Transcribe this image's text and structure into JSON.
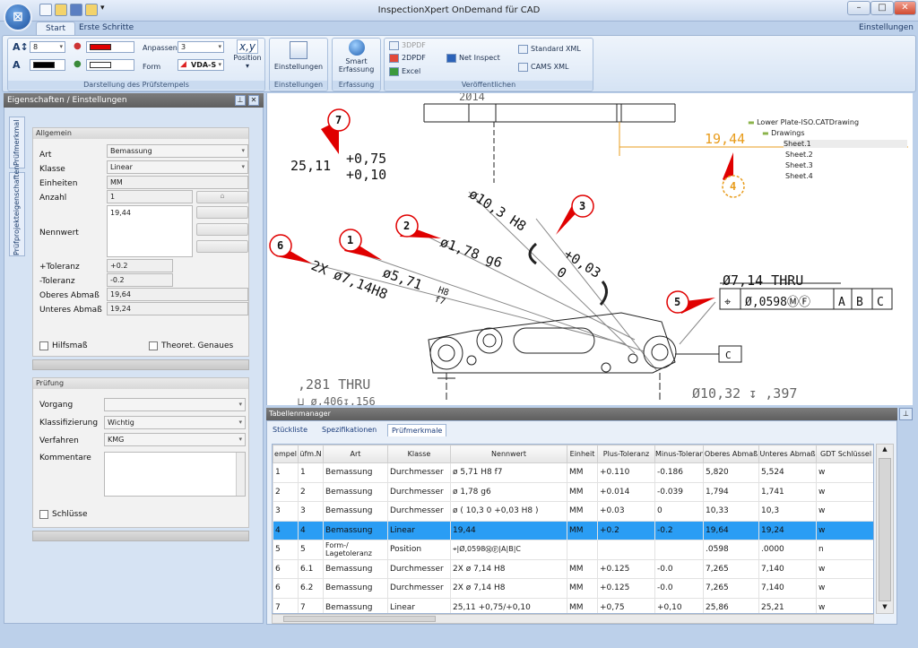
{
  "window": {
    "title": "InspectionXpert OnDemand für CAD",
    "minimize": "–",
    "maximize": "□",
    "close": "✕"
  },
  "app_button": "⊠",
  "ribbon": {
    "tabs": [
      {
        "label": "Start"
      },
      {
        "label": "Erste Schritte"
      }
    ],
    "settings_label": "Einstellungen ▾",
    "font_size": "8",
    "anpassen_label": "Anpassen",
    "anpassen_value": "3",
    "form_label": "Form",
    "form_value": "VDA-S",
    "position_label": "Position",
    "group_stamps": "Darstellung des Prüfstempels",
    "settings_button": "Einstellungen",
    "group_settings": "Einstellungen",
    "smart_button_1": "Smart",
    "smart_button_2": "Erfassung",
    "group_capture": "Erfassung",
    "btn_3dpdf": "3DPDF",
    "btn_2dpdf": "2DPDF",
    "btn_excel": "Excel",
    "btn_net_inspect": "Net Inspect",
    "btn_standard_xml": "Standard XML",
    "btn_cams_xml": "CAMS XML",
    "group_publish": "Veröffentlichen",
    "colors": {
      "stamp_color": "#e00000",
      "text_color": "#000000"
    }
  },
  "properties": {
    "title": "Eigenschaften / Einstellungen",
    "side_tabs": [
      "Prüfmerkmal",
      "Prüfprojekteigenschaften"
    ],
    "general_header": "Allgemein",
    "rows": [
      {
        "label": "Art",
        "value": "Bemassung"
      },
      {
        "label": "Klasse",
        "value": "Linear"
      },
      {
        "label": "Einheiten",
        "value": "MM"
      },
      {
        "label": "Anzahl",
        "value": "1"
      }
    ],
    "nennwert_label": "Nennwert",
    "nennwert_value": "19,44",
    "tol_rows": [
      {
        "label": "+Toleranz",
        "value": "+0.2"
      },
      {
        "label": "-Toleranz",
        "value": "-0.2"
      },
      {
        "label": "Oberes Abmaß",
        "value": "19,64"
      },
      {
        "label": "Unteres Abmaß",
        "value": "19,24"
      }
    ],
    "hilfsmass": "Hilfsmaß",
    "theoret": "Theoret. Genaues",
    "pruefung_header": "Prüfung",
    "vorgang_label": "Vorgang",
    "vorgang_value": "",
    "klass_label": "Klassifizierung",
    "klass_value": "Wichtig",
    "verfahren_label": "Verfahren",
    "verfahren_value": "KMG",
    "kommentare_label": "Kommentare",
    "schluesse": "Schlüsse"
  },
  "drawing": {
    "tree": {
      "root": "Lower Plate-ISO.CATDrawing",
      "drawings": "Drawings",
      "sheets": [
        "Sheet.1",
        "Sheet.2",
        "Sheet.3",
        "Sheet.4"
      ]
    },
    "balloons": [
      "7",
      "2",
      "3",
      "1",
      "6",
      "4",
      "5"
    ],
    "dims": {
      "d7a": "25,11",
      "d7b": "+0,75",
      "d7c": "+0,10",
      "d4": "19,44",
      "d3a": "ø10,3 H8",
      "d3b": "+0,03",
      "d3c": "0",
      "d2": "ø1,78 g6",
      "d1a": "ø5,71",
      "d1b": "H8",
      "d1c": "f7",
      "d6": "2X ø7,14H8",
      "d5": "Ø7,14 THRU",
      "fcf": [
        "⌖",
        "Ø,0598ⓂⒻ",
        "A",
        "B",
        "C"
      ],
      "datum_c": "C",
      "thru281": ",281 THRU",
      "depth406": "⊔ ø,406↧,156",
      "d1032": "Ø10,32 ↧ ,397",
      "top14": "2Ø14"
    }
  },
  "table_manager": {
    "title": "Tabellenmanager",
    "tabs": [
      {
        "label": "Stückliste"
      },
      {
        "label": "Spezifikationen"
      },
      {
        "label": "Prüfmerkmale"
      }
    ],
    "columns": [
      "empel",
      "üfm.N",
      "Art",
      "Klasse",
      "Nennwert",
      "Einheit",
      "Plus-Toleranz",
      "Minus-Toleran",
      "Oberes Abmaß",
      "Unteres Abmaß",
      "GDT Schlüssel"
    ],
    "rows": [
      [
        "1",
        "1",
        "Bemassung",
        "Durchmesser",
        "ø 5,71 H8  f7",
        "MM",
        "+0.110",
        "-0.186",
        "5,820",
        "5,524",
        "w"
      ],
      [
        "2",
        "2",
        "Bemassung",
        "Durchmesser",
        "ø 1,78 g6",
        "MM",
        "+0.014",
        "-0.039",
        "1,794",
        "1,741",
        "w"
      ],
      [
        "3",
        "3",
        "Bemassung",
        "Durchmesser",
        "ø ( 10,3 0 +0,03 H8    )",
        "MM",
        "+0.03",
        "0",
        "10,33",
        "10,3",
        "w"
      ],
      [
        "4",
        "4",
        "Bemassung",
        "Linear",
        "19,44",
        "MM",
        "+0.2",
        "-0.2",
        "19,64",
        "19,24",
        "w"
      ],
      [
        "5",
        "5",
        "Form-/ Lagetoleranz",
        "Position",
        "⌖|Ø,0598ⓂⒻ|A|B|C",
        "",
        "",
        "",
        ".0598",
        ".0000",
        "n"
      ],
      [
        "6",
        "6.1",
        "Bemassung",
        "Durchmesser",
        "2X   ø 7,14 H8",
        "MM",
        "+0.125",
        "-0.0",
        "7,265",
        "7,140",
        "w"
      ],
      [
        "6",
        "6.2",
        "Bemassung",
        "Durchmesser",
        "2X   ø 7,14 H8",
        "MM",
        "+0.125",
        "-0.0",
        "7,265",
        "7,140",
        "w"
      ],
      [
        "7",
        "7",
        "Bemassung",
        "Linear",
        "25,11 +0,75/+0,10",
        "MM",
        "+0,75",
        "+0,10",
        "25,86",
        "25,21",
        "w"
      ]
    ],
    "selected_row": 3
  }
}
